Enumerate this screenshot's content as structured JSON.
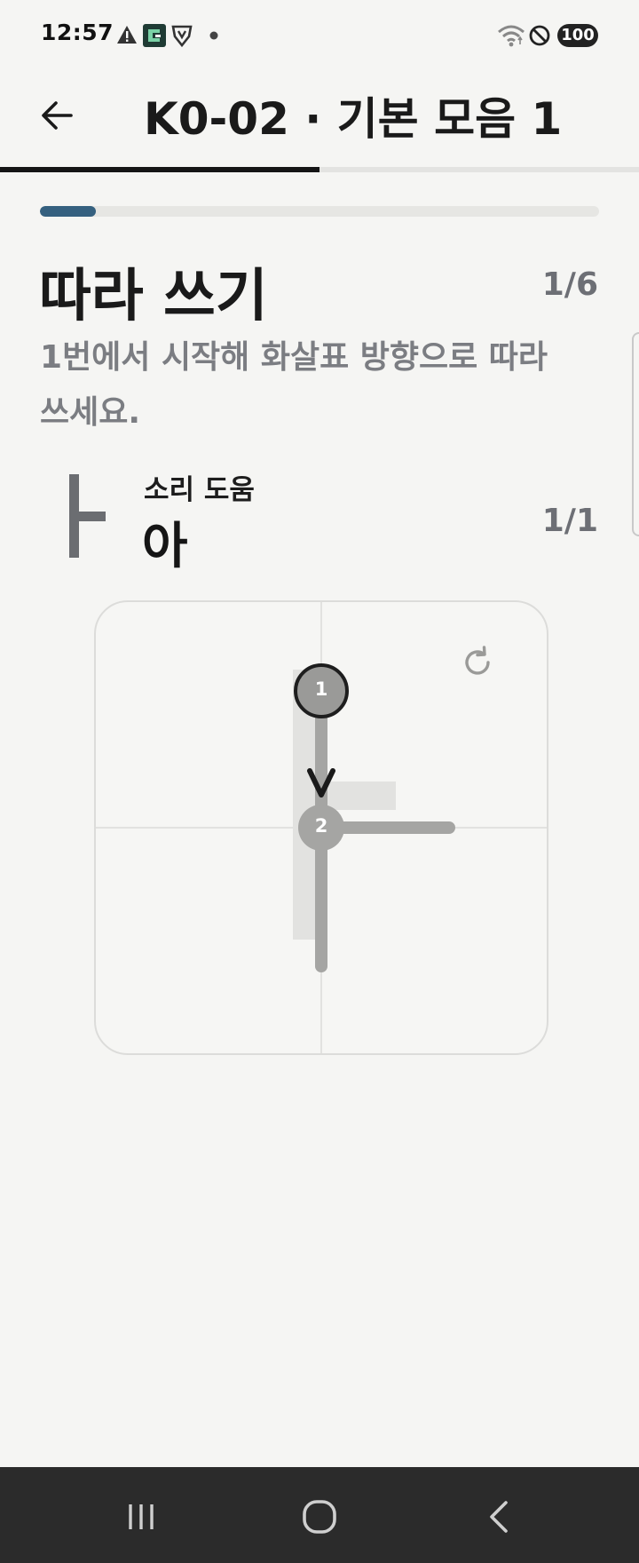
{
  "status_bar": {
    "time": "12:57",
    "icons": [
      "warning-icon",
      "app-notification-icon",
      "vpn-shield-icon",
      "dot-icon",
      "wifi-icon",
      "do-not-disturb-icon"
    ],
    "battery": "100"
  },
  "app_bar": {
    "back_icon": "arrow-left-icon",
    "title": "K0-02 · 기본 모음 1",
    "lesson_progress": 0.5
  },
  "exercise": {
    "step_progress": 0.1,
    "title": "따라 쓰기",
    "counter": "1/6",
    "instruction": "1번에서 시작해 화살표 방향으로 따라 쓰세요."
  },
  "letter": {
    "glyph_icon": "vowel-a-glyph",
    "sound_label": "소리 도움",
    "sound_value": "아",
    "counter": "1/1"
  },
  "canvas": {
    "reset_icon": "refresh-icon",
    "strokes": [
      {
        "number": "1",
        "direction": "down",
        "active": true
      },
      {
        "number": "2",
        "direction": "right",
        "active": false
      }
    ]
  },
  "nav_bar": {
    "recent_icon": "recent-apps-icon",
    "home_icon": "home-icon",
    "back_icon": "nav-back-icon"
  },
  "colors": {
    "background": "#f5f5f3",
    "accent": "#35607f",
    "text_primary": "#1a1a1a",
    "text_secondary": "#7b7d82",
    "stroke_gray": "#a5a5a3",
    "guide_gray": "#e2e2e0"
  }
}
